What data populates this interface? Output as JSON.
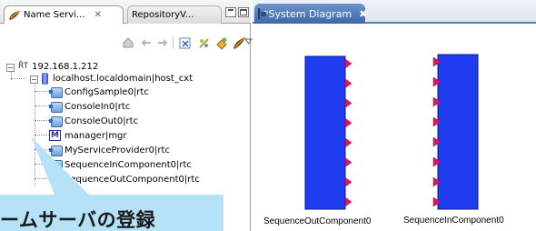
{
  "left_view": {
    "tabs": [
      {
        "label": "Name Servi...",
        "close": "✕"
      },
      {
        "label": "RepositoryV..."
      }
    ],
    "toolbar_icons": [
      "home-icon",
      "back-arrow-icon",
      "forward-arrow-icon",
      "refresh-icon",
      "zoom-icon",
      "connect-icon",
      "link-icon",
      "view-menu-icon"
    ],
    "tree": {
      "root": {
        "prefix": "ŘT",
        "label": "192.168.1.212",
        "expander": "−"
      },
      "host": {
        "label": "localhost.localdomain|host_cxt",
        "expander": "−"
      },
      "items": [
        {
          "label": "ConfigSample0|rtc",
          "icon": "rtc-component-icon"
        },
        {
          "label": "ConsoleIn0|rtc",
          "icon": "rtc-component-icon"
        },
        {
          "label": "ConsoleOut0|rtc",
          "icon": "rtc-component-icon"
        },
        {
          "label": "manager|mgr",
          "icon": "manager-icon",
          "icon_glyph": "M"
        },
        {
          "label": "MyServiceProvider0|rtc",
          "icon": "rtc-component-icon"
        },
        {
          "label": "SequenceInComponent0|rtc",
          "icon": "rtc-component-icon"
        },
        {
          "label": "SequenceOutComponent0|rtc",
          "icon": "rtc-component-icon"
        }
      ]
    },
    "callout": {
      "text": "ームサーバの登録",
      "color": "#b6e2f7"
    }
  },
  "editor": {
    "tab": {
      "label": "*System Diagram",
      "close": "✖"
    },
    "components": [
      {
        "label": "SequenceOutComponent0",
        "fill": "#1f3cf0",
        "port_color": "#e0126a",
        "port_side": "right",
        "port_count": 8
      },
      {
        "label": "SequenceInComponent0",
        "fill": "#1f3cf0",
        "port_color": "#e0126a",
        "port_side": "left",
        "port_count": 8
      }
    ]
  }
}
